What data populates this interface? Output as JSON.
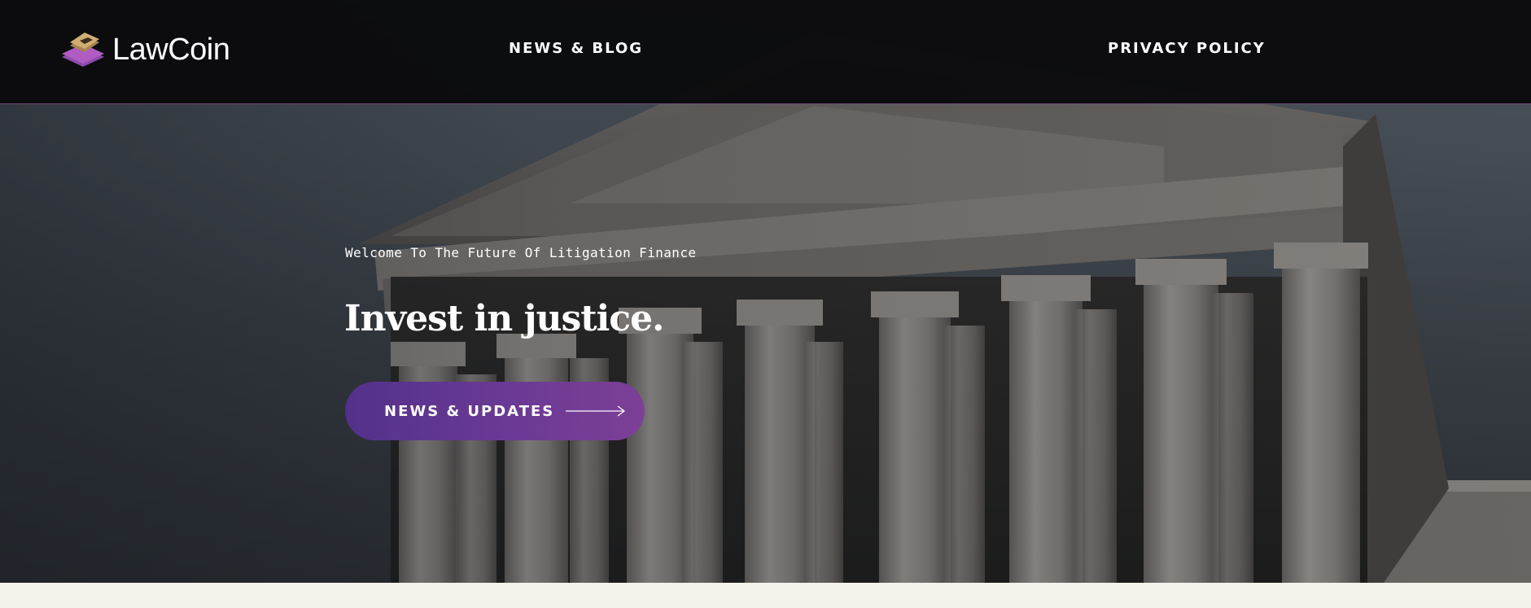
{
  "brand": {
    "name": "LawCoin",
    "logo_icon": "stacked-layers-logo-icon"
  },
  "nav": {
    "items": [
      {
        "label": "NEWS & BLOG"
      },
      {
        "label": "PRIVACY POLICY"
      }
    ]
  },
  "hero": {
    "eyebrow": "Welcome To The Future Of Litigation Finance",
    "headline": "Invest in justice.",
    "background": "supreme-court-building-photo",
    "cta": {
      "label": "NEWS & UPDATES",
      "icon": "long-arrow-right-icon"
    }
  },
  "colors": {
    "header_bg": "#0b0b0d",
    "cta_start": "#53318a",
    "cta_end": "#7d3f97",
    "logo_gold": "#c9a46a",
    "logo_purple": "#9b4fb6",
    "footer_strip": "#f5f2ec"
  }
}
